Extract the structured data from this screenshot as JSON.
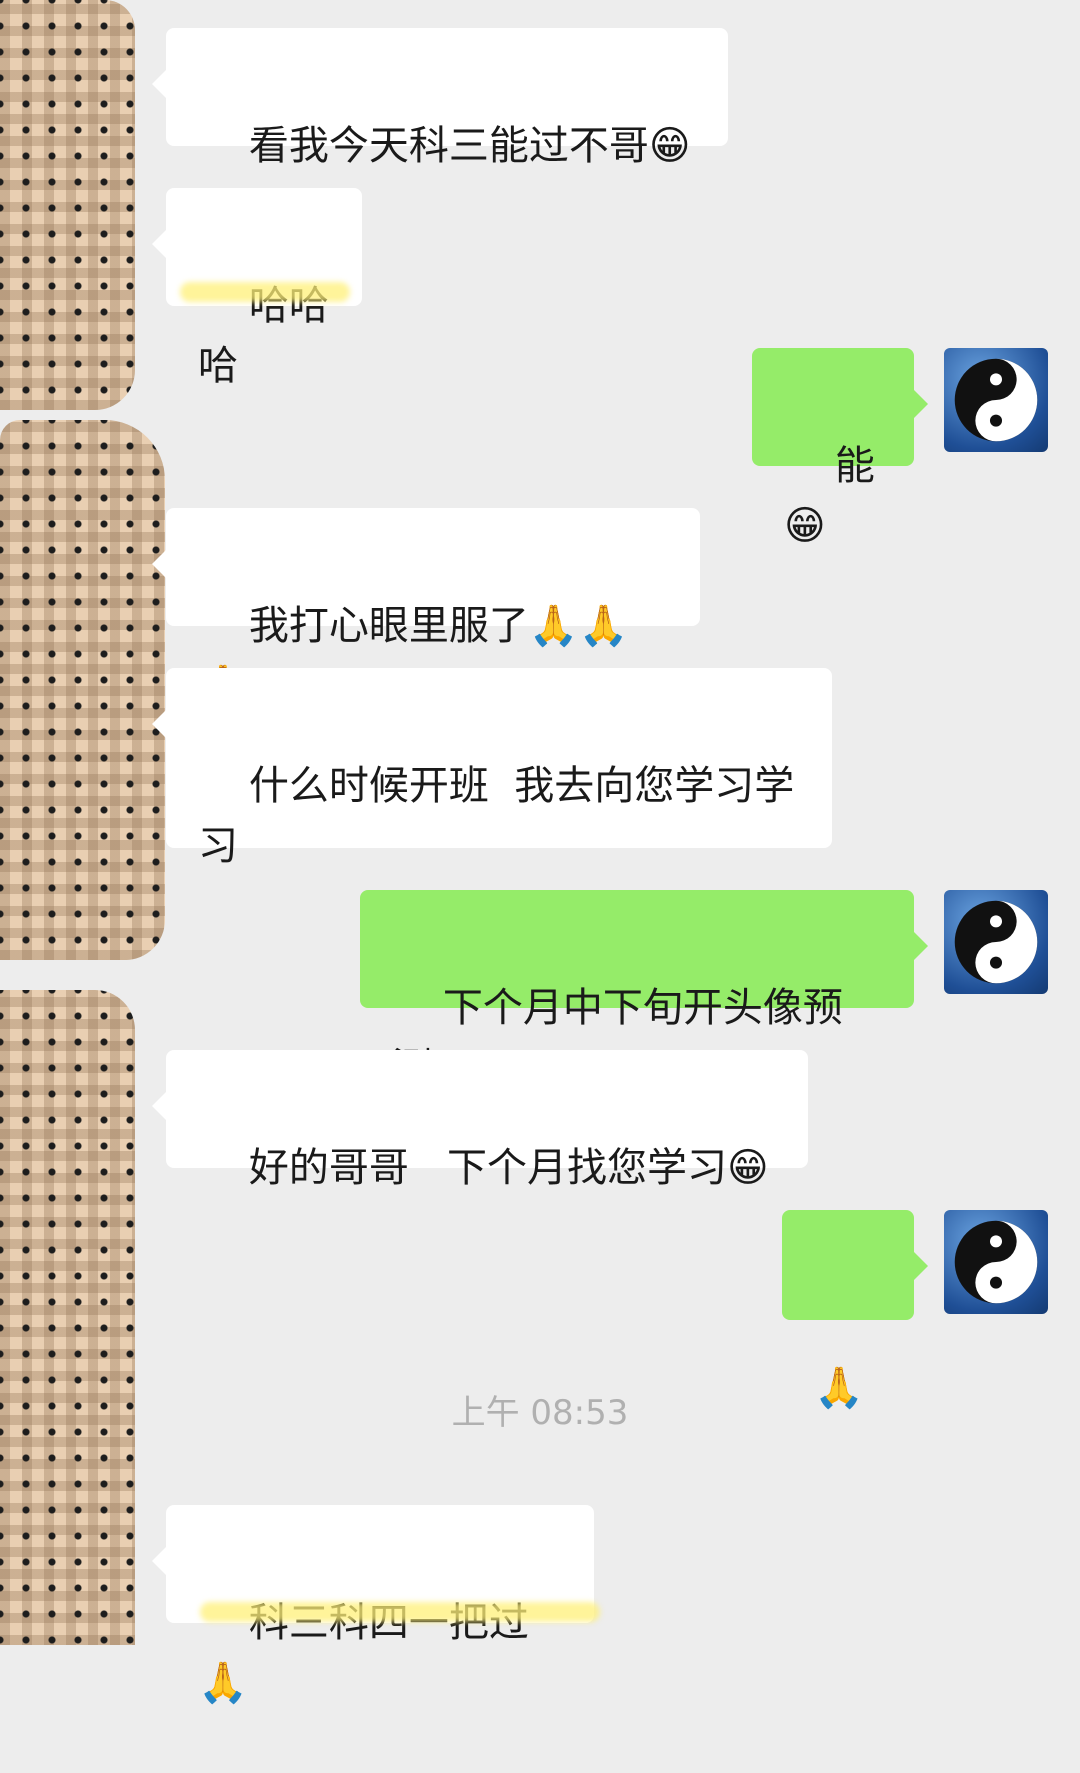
{
  "messages": [
    {
      "from": "other",
      "text": "看我今天科三能过不哥",
      "emoji": "😁"
    },
    {
      "from": "other",
      "text": "哈哈哈",
      "emoji": ""
    },
    {
      "from": "me",
      "text": "能",
      "emoji": "😁"
    },
    {
      "from": "other",
      "text": "我打心眼里服了",
      "emoji": "🙏🙏🙏"
    },
    {
      "from": "other",
      "text": "什么时候开班  我去向您学习学习",
      "emoji": ""
    },
    {
      "from": "me",
      "text": "下个月中下旬开头像预测",
      "emoji": ""
    },
    {
      "from": "other",
      "text": "好的哥哥   下个月找您学习",
      "emoji": "😁"
    },
    {
      "from": "me",
      "text": "",
      "emoji": "🙏"
    },
    {
      "from": "other",
      "text": "科三科四一把过",
      "emoji": "🙏"
    }
  ],
  "timestamp": "上午 08:53",
  "my_avatar_icon": "yin-yang-icon",
  "colors": {
    "incoming": "#ffffff",
    "outgoing": "#95ec69",
    "background": "#ededed"
  }
}
